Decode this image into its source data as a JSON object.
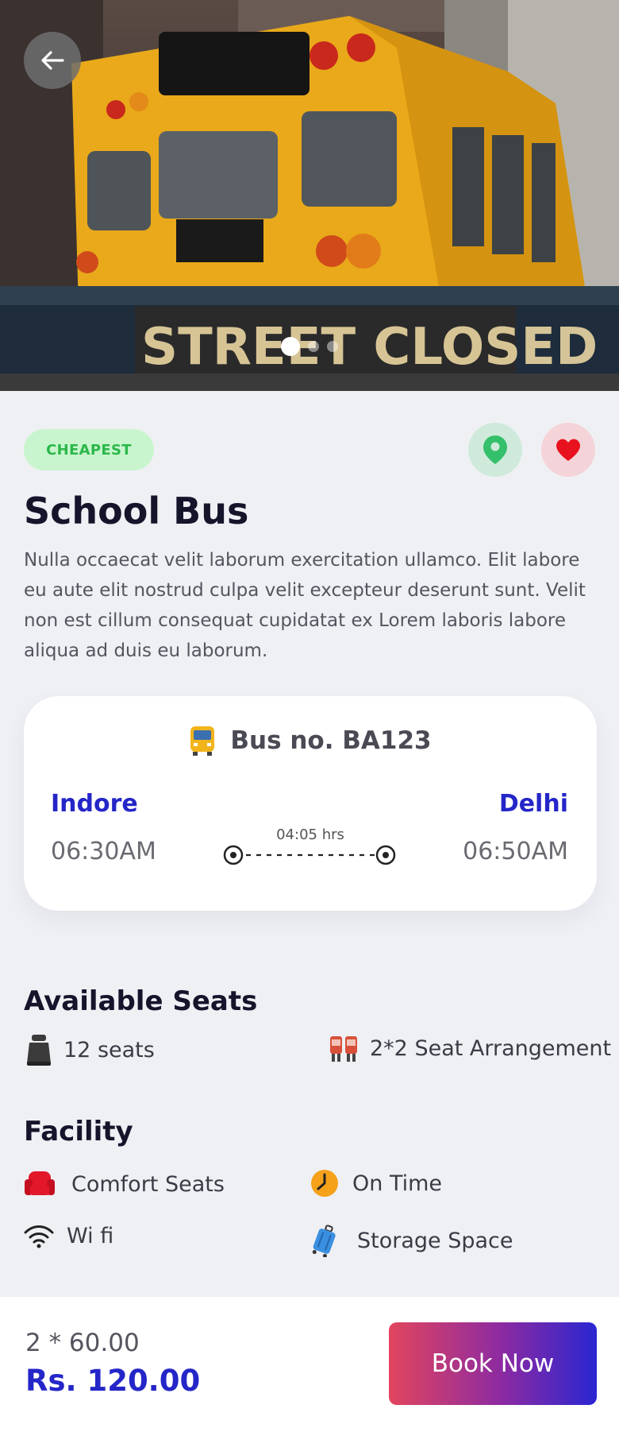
{
  "header": {
    "back_icon": "arrow-left-icon",
    "carousel": {
      "count": 3,
      "active": 0
    }
  },
  "tag": {
    "label": "CHEAPEST"
  },
  "actions": {
    "location_icon": "map-pin-icon",
    "favorite_icon": "heart-icon"
  },
  "title": "School Bus",
  "description": "Nulla occaecat velit laborum exercitation ullamco. Elit labore eu aute elit nostrud culpa velit excepteur deserunt sunt. Velit non est cillum consequat cupidatat ex Lorem laboris labore aliqua ad duis eu laborum.",
  "trip": {
    "bus_label": "Bus no. BA123",
    "from_city": "Indore",
    "to_city": "Delhi",
    "depart_time": "06:30AM",
    "arrive_time": "06:50AM",
    "duration": "04:05 hrs"
  },
  "seats": {
    "heading": "Available Seats",
    "count_label": "12 seats",
    "arrangement_label": "2*2 Seat Arrangement"
  },
  "facility": {
    "heading": "Facility",
    "items": [
      {
        "label": "Comfort Seats",
        "icon": "armchair-icon"
      },
      {
        "label": "On Time",
        "icon": "clock-icon"
      },
      {
        "label": "Wi fi",
        "icon": "wifi-icon"
      },
      {
        "label": "Storage Space",
        "icon": "luggage-icon"
      }
    ]
  },
  "footer": {
    "calc": "2 * 60.00",
    "total": "Rs. 120.00",
    "book_label": "Book Now"
  },
  "colors": {
    "accent": "#2426c8",
    "badge_bg": "#c8f5cd",
    "badge_text": "#2bb84a",
    "heart": "#e8121f",
    "pin": "#34c06a"
  }
}
